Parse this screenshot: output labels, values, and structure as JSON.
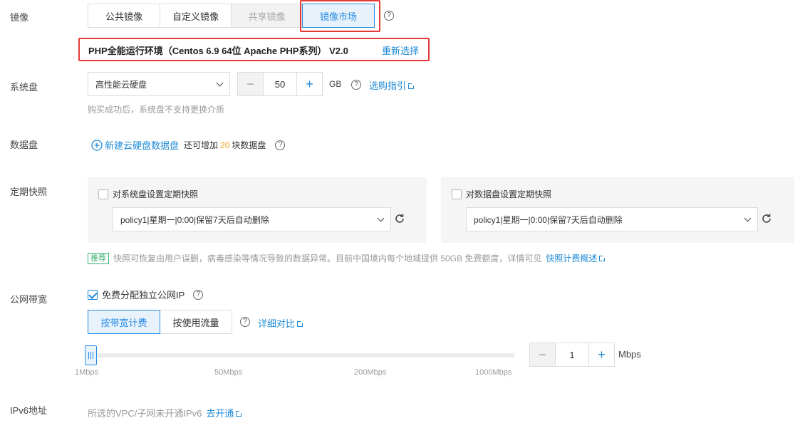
{
  "image": {
    "label": "镜像",
    "tabs": [
      {
        "label": "公共镜像",
        "state": "normal"
      },
      {
        "label": "自定义镜像",
        "state": "normal"
      },
      {
        "label": "共享镜像",
        "state": "disabled"
      },
      {
        "label": "镜像市场",
        "state": "active"
      }
    ],
    "selected": "PHP全能运行环境（Centos 6.9 64位 Apache PHP系列） V2.0",
    "reselect": "重新选择"
  },
  "system_disk": {
    "label": "系统盘",
    "type": "高性能云硬盘",
    "size": "50",
    "unit": "GB",
    "guide_link": "选购指引",
    "hint": "购买成功后，系统盘不支持更换介质"
  },
  "data_disk": {
    "label": "数据盘",
    "add_link": "新建云硬盘数据盘",
    "quota_prefix": "还可增加",
    "quota_num": "20",
    "quota_suffix": "块数据盘"
  },
  "snapshot": {
    "label": "定期快照",
    "system": {
      "checkbox_label": "对系统盘设置定期快照",
      "policy": "policy1|星期一|0:00|保留7天后自动删除"
    },
    "data": {
      "checkbox_label": "对数据盘设置定期快照",
      "policy": "policy1|星期一|0:00|保留7天后自动删除"
    },
    "tag": "推荐",
    "tip": "快照可恢复由用户误删，病毒感染等情况导致的数据异常。目前中国境内每个地域提供 50GB 免费额度，详情可见",
    "tip_link": "快照计费概述"
  },
  "bandwidth": {
    "label": "公网带宽",
    "free_ip_label": "免费分配独立公网IP",
    "free_ip_checked": true,
    "billing_tabs": [
      {
        "label": "按带宽计费",
        "state": "active"
      },
      {
        "label": "按使用流量",
        "state": "normal"
      }
    ],
    "compare_link": "详细对比",
    "ticks": [
      "1Mbps",
      "50Mbps",
      "200Mbps",
      "1000Mbps"
    ],
    "value": "1",
    "unit": "Mbps",
    "slider_fraction": 0.0
  },
  "ipv6": {
    "label": "IPv6地址",
    "text": "所选的VPC/子网未开通IPv6",
    "link": "去开通"
  },
  "colors": {
    "accent": "#2a8ce6",
    "highlight": "#e53935",
    "recommend": "#37b36b",
    "quota": "#f0a020"
  }
}
